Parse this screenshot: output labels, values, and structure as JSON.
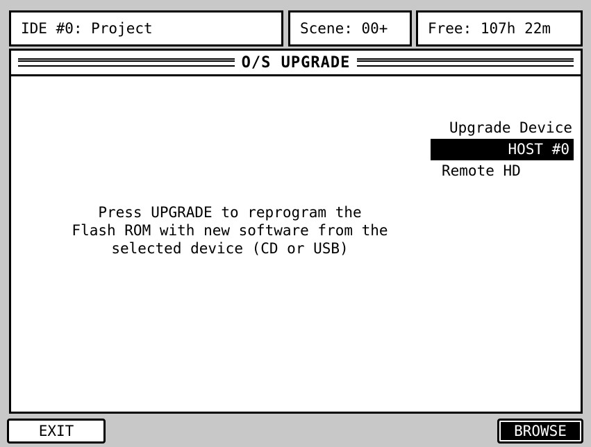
{
  "status_bar": {
    "drive": "IDE #0: Project",
    "scene": "Scene: 00+",
    "free": "Free: 107h 22m"
  },
  "page": {
    "title": "O/S UPGRADE"
  },
  "message": {
    "line1": "Press UPGRADE to reprogram the",
    "line2": "Flash ROM with new software from the",
    "line3": "selected device (CD or USB)"
  },
  "upgrade_device": {
    "heading": "Upgrade Device",
    "options": [
      "HOST #0",
      "Remote HD"
    ],
    "selected": "HOST #0"
  },
  "soft_keys": {
    "exit": "EXIT",
    "browse": "BROWSE"
  }
}
